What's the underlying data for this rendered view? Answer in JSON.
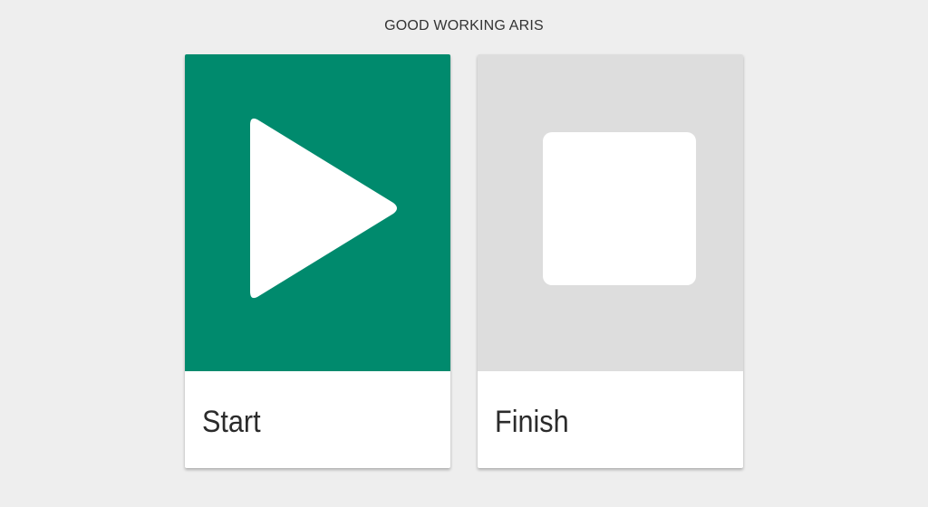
{
  "header": {
    "title": "GOOD WORKING ARIS"
  },
  "cards": [
    {
      "id": "start",
      "label": "Start",
      "icon": "play-icon",
      "media_color": "#008a6d",
      "icon_color": "#ffffff"
    },
    {
      "id": "finish",
      "label": "Finish",
      "icon": "stop-icon",
      "media_color": "#dddddd",
      "icon_color": "#ffffff"
    }
  ]
}
